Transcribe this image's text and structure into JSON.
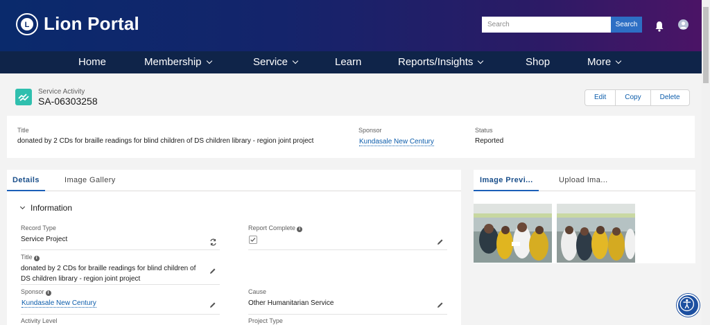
{
  "header": {
    "brand": "Lion Portal",
    "search_placeholder": "Search",
    "search_button": "Search"
  },
  "nav": [
    {
      "label": "Home",
      "dropdown": false
    },
    {
      "label": "Membership",
      "dropdown": true
    },
    {
      "label": "Service",
      "dropdown": true
    },
    {
      "label": "Learn",
      "dropdown": false
    },
    {
      "label": "Reports/Insights",
      "dropdown": true
    },
    {
      "label": "Shop",
      "dropdown": false
    },
    {
      "label": "More",
      "dropdown": true
    }
  ],
  "record": {
    "object_type": "Service Activity",
    "name": "SA-06303258",
    "actions": [
      "Edit",
      "Copy",
      "Delete"
    ]
  },
  "highlights": {
    "title_label": "Title",
    "title_value": "donated by 2 CDs for braille readings for blind children of DS children library - region joint project",
    "sponsor_label": "Sponsor",
    "sponsor_value": "Kundasale New Century",
    "status_label": "Status",
    "status_value": "Reported"
  },
  "details": {
    "tabs": [
      "Details",
      "Image Gallery"
    ],
    "section_title": "Information",
    "fields": {
      "record_type_label": "Record Type",
      "record_type_value": "Service Project",
      "report_complete_label": "Report Complete",
      "report_complete_checked": true,
      "title_label": "Title",
      "title_value": "donated by 2 CDs for braille readings for blind children of DS children library - region joint project",
      "sponsor_label": "Sponsor",
      "sponsor_value": "Kundasale New Century",
      "cause_label": "Cause",
      "cause_value": "Other Humanitarian Service",
      "activity_level_label": "Activity Level",
      "project_type_label": "Project Type"
    }
  },
  "images": {
    "tabs": [
      "Image Previ...",
      "Upload Ima..."
    ]
  },
  "colors": {
    "nav_bg": "#0f2449",
    "accent": "#0b5cab",
    "record_icon": "#2fbfae"
  }
}
